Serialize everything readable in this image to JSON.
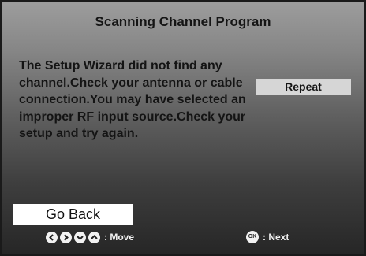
{
  "dialog": {
    "title": "Scanning Channel Program",
    "message": "The Setup Wizard did not find any channel.Check your antenna or cable connection.You may have selected an improper RF input source.Check your setup and try again."
  },
  "buttons": {
    "repeat_label": "Repeat",
    "go_back_label": "Go Back"
  },
  "footer": {
    "move_label": ": Move",
    "ok_icon_text": "OK",
    "next_label": ": Next",
    "nav_icons": [
      "left-arrow-icon",
      "right-arrow-icon",
      "down-arrow-icon",
      "up-arrow-icon"
    ]
  },
  "colors": {
    "gradient_top": "#9d9d9d",
    "gradient_bottom": "#262626",
    "repeat_button_bg": "#d6d6d6",
    "go_back_button_bg": "#ffffff"
  }
}
